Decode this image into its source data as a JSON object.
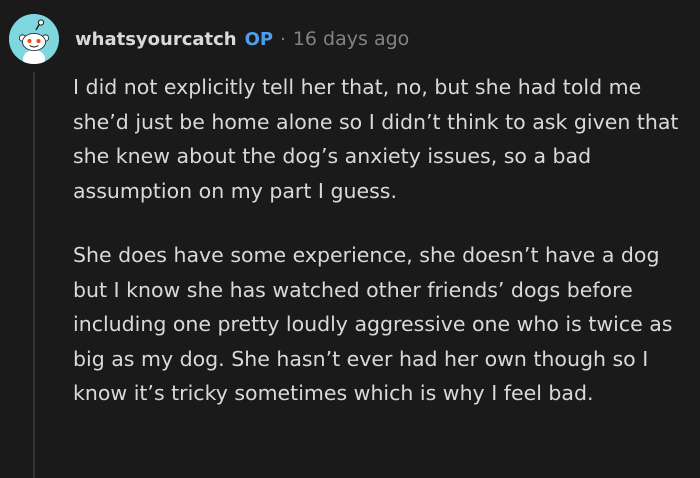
{
  "comment": {
    "author": "whatsyourcatch",
    "op_badge": "OP",
    "separator": "·",
    "timestamp": "16 days ago",
    "paragraphs": [
      "I did not explicitly tell her that, no, but she had told me she’d just be home alone so I didn’t think to ask given that she knew about the dog’s anxiety issues, so a bad assumption on my part I guess.",
      "She does have some experience, she doesn’t have a dog but I know she has watched other friends’ dogs before including one pretty loudly aggressive one who is twice as big as my dog. She hasn’t ever had her own though so I know it’s tricky sometimes which is why I feel bad."
    ]
  },
  "colors": {
    "background": "#1a1a1b",
    "text": "#d7dadc",
    "meta": "#818384",
    "op_accent": "#4f9eed",
    "avatar_bg": "#7ed6df",
    "thread_line": "#343536"
  },
  "icons": {
    "avatar": "snoo-avatar-icon"
  }
}
